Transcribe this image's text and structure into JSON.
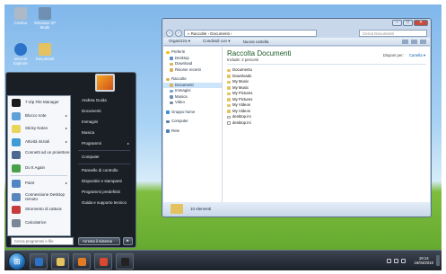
{
  "desktop": {
    "icons": [
      {
        "label": "Cestino",
        "name": "recycle-bin",
        "color": "#aeb9c7"
      },
      {
        "label": "Windows XP Mode",
        "name": "xp-mode",
        "color": "#6f8fb3"
      },
      {
        "label": "Internet Explorer",
        "name": "internet-explorer",
        "color": "#2a73c8"
      },
      {
        "label": "Documenti",
        "name": "documents",
        "color": "#e4c25f"
      }
    ]
  },
  "explorer": {
    "address": "« Raccolte › Documenti ›",
    "search_placeholder": "Cerca Documenti",
    "toolbar": {
      "organize": "Organizza ▾",
      "share": "Condividi con ▾",
      "new_folder": "Nuova cartella"
    },
    "controls": {
      "minimize": "–",
      "maximize": "□",
      "close": "✕"
    },
    "nav": {
      "favorites": "Preferiti",
      "favorites_items": [
        "Desktop",
        "Download",
        "Risorse recenti"
      ],
      "libraries": "Raccolte",
      "libraries_items": [
        "Documenti",
        "Immagini",
        "Musica",
        "Video"
      ],
      "homegroup": "Gruppo home",
      "computer": "Computer",
      "network": "Rete"
    },
    "main": {
      "title": "Raccolta Documenti",
      "includes": "Include: 2 percorsi",
      "arrange_label": "Disponi per:",
      "arrange_value": "Cartella ▾",
      "items": [
        {
          "label": "Documento",
          "type": "folder"
        },
        {
          "label": "Downloads",
          "type": "folder"
        },
        {
          "label": "My Music",
          "type": "folder"
        },
        {
          "label": "My Music",
          "type": "folder"
        },
        {
          "label": "My Pictures",
          "type": "folder"
        },
        {
          "label": "My Pictures",
          "type": "folder"
        },
        {
          "label": "My Videos",
          "type": "folder"
        },
        {
          "label": "My Videos",
          "type": "folder"
        },
        {
          "label": "desktop.ini",
          "type": "file"
        },
        {
          "label": "desktop.ini",
          "type": "file"
        }
      ]
    },
    "details": "10 elementi"
  },
  "start_menu": {
    "programs": [
      {
        "label": "7-Zip File Manager",
        "color": "#1b1b1b",
        "arrow": ""
      },
      {
        "label": "Blocco note",
        "color": "#5fa0d8",
        "arrow": "▸"
      },
      {
        "label": "Sticky Notes",
        "color": "#e8d55a",
        "arrow": "▸"
      },
      {
        "label": "Attività iniziali",
        "color": "#3f9bd6",
        "arrow": "▸"
      },
      {
        "label": "Connetti ad un proiettore",
        "color": "#4b6a8f",
        "arrow": ""
      },
      {
        "label": "Do It Again",
        "color": "#48a048",
        "arrow": ""
      },
      {
        "label": "Paint",
        "color": "#4f86c6",
        "arrow": "▸"
      },
      {
        "label": "Connessione Desktop remoto",
        "color": "#5a86bd",
        "arrow": ""
      },
      {
        "label": "Strumento di cattura",
        "color": "#c63c3c",
        "arrow": ""
      },
      {
        "label": "Calcolatrice",
        "color": "#7a8796",
        "arrow": ""
      }
    ],
    "all_programs": "Tutti i programmi",
    "right": [
      {
        "label": "Andrea Guida",
        "arrow": ""
      },
      {
        "label": "Documenti",
        "arrow": ""
      },
      {
        "label": "Immagini",
        "arrow": ""
      },
      {
        "label": "Musica",
        "arrow": ""
      },
      {
        "label": "Programmi",
        "arrow": "▸"
      },
      {
        "label": "Computer",
        "arrow": ""
      },
      {
        "label": "Pannello di controllo",
        "arrow": ""
      },
      {
        "label": "Dispositivi e stampanti",
        "arrow": ""
      },
      {
        "label": "Programmi predefiniti",
        "arrow": ""
      },
      {
        "label": "Guida e supporto tecnico",
        "arrow": ""
      }
    ],
    "search_placeholder": "Cerca programmi e file",
    "lock_label": "Arresta il sistema",
    "power_arrow": "▸"
  },
  "taskbar": {
    "start_glyph": "⊞",
    "buttons": [
      {
        "name": "internet-explorer",
        "color": "#2a73c8"
      },
      {
        "name": "explorer",
        "color": "#e4c25f"
      },
      {
        "name": "media-player",
        "color": "#e47a24"
      },
      {
        "name": "chrome",
        "color": "#d9482f"
      },
      {
        "name": "7zip",
        "color": "#222222"
      }
    ],
    "time": "19:14",
    "date": "16/04/2010"
  }
}
